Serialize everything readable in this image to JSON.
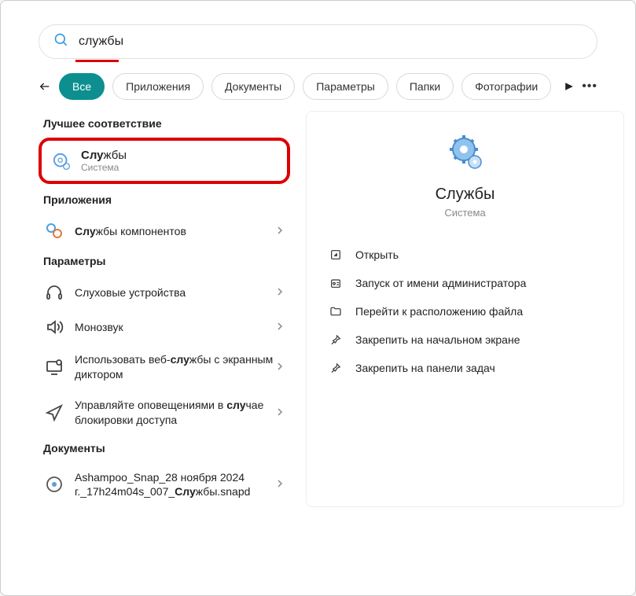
{
  "search": {
    "query": "службы"
  },
  "tabs": {
    "all": "Все",
    "apps": "Приложения",
    "docs": "Документы",
    "settings": "Параметры",
    "folders": "Папки",
    "photos": "Фотографии"
  },
  "sections": {
    "best": "Лучшее соответствие",
    "apps": "Приложения",
    "settings": "Параметры",
    "docs": "Документы"
  },
  "best": {
    "title_pre": "Слу",
    "title_post": "жбы",
    "sub": "Система"
  },
  "appsList": {
    "item0_pre": "Слу",
    "item0_post": "жбы компонентов"
  },
  "settingsList": {
    "item0": "Слуховые устройства",
    "item1": "Монозвук",
    "item2_pre": "Использовать веб-",
    "item2_mid": "слу",
    "item2_post": "жбы с экранным диктором",
    "item3_pre": "Управляйте оповещениями в ",
    "item3_mid": "слу",
    "item3_post": "чае блокировки доступа"
  },
  "docsList": {
    "item0_pre": "Ashampoo_Snap_28 ноября 2024 г._17h24m04s_007_",
    "item0_mid": "Слу",
    "item0_post": "жбы.snapd"
  },
  "details": {
    "title": "Службы",
    "sub": "Система"
  },
  "actions": {
    "open": "Открыть",
    "admin": "Запуск от имени администратора",
    "filelocation": "Перейти к расположению файла",
    "pinstart": "Закрепить на начальном экране",
    "pintaskbar": "Закрепить на панели задач"
  }
}
